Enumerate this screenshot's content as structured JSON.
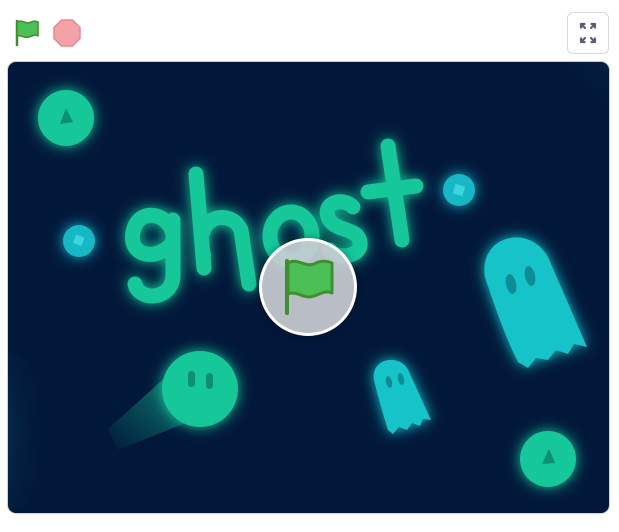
{
  "toolbar": {
    "green_flag_icon": "green-flag-icon",
    "stop_icon": "stop-sign-icon",
    "fullscreen_icon": "fullscreen-icon"
  },
  "stage": {
    "logo_text": "ghost",
    "background_color": "#02183a",
    "accent_green": "#14c79a",
    "accent_cyan": "#12c3c9",
    "overlay_icon": "green-flag-icon"
  }
}
